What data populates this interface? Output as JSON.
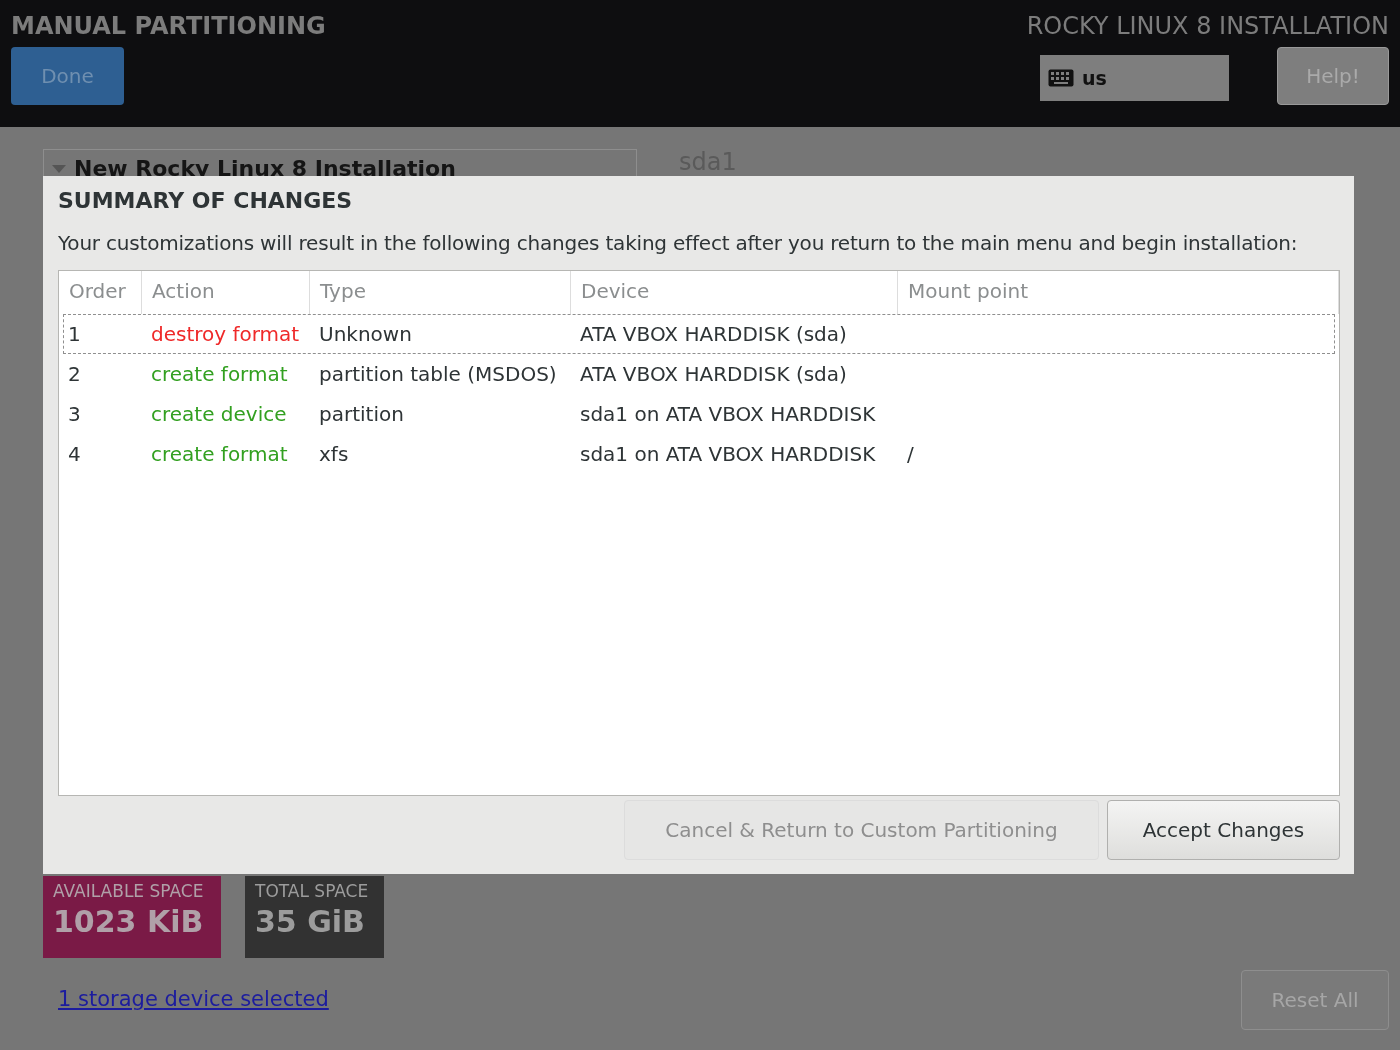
{
  "header": {
    "title": "MANUAL PARTITIONING",
    "done_button": "Done",
    "product": "ROCKY LINUX 8 INSTALLATION",
    "keyboard_layout": "us",
    "help_button": "Help!"
  },
  "background": {
    "tree_heading": "New Rocky Linux 8 Installation",
    "device_title": "sda1",
    "available_space": {
      "label": "AVAILABLE SPACE",
      "value": "1023 KiB"
    },
    "total_space": {
      "label": "TOTAL SPACE",
      "value": "35 GiB"
    },
    "storage_link": "1 storage device selected",
    "reset_button": "Reset All"
  },
  "dialog": {
    "title": "SUMMARY OF CHANGES",
    "message": "Your customizations will result in the following changes taking effect after you return to the main menu and begin installation:",
    "table": {
      "columns": [
        "Order",
        "Action",
        "Type",
        "Device",
        "Mount point"
      ],
      "rows": [
        {
          "order": "1",
          "action": "destroy format",
          "kind": "destroy",
          "type": "Unknown",
          "device": "ATA VBOX HARDDISK (sda)",
          "mount_point": "",
          "selected": true
        },
        {
          "order": "2",
          "action": "create format",
          "kind": "create",
          "type": "partition table (MSDOS)",
          "device": "ATA VBOX HARDDISK (sda)",
          "mount_point": "",
          "selected": false
        },
        {
          "order": "3",
          "action": "create device",
          "kind": "create",
          "type": "partition",
          "device": "sda1 on ATA VBOX HARDDISK",
          "mount_point": "",
          "selected": false
        },
        {
          "order": "4",
          "action": "create format",
          "kind": "create",
          "type": "xfs",
          "device": "sda1 on ATA VBOX HARDDISK",
          "mount_point": "/",
          "selected": false
        }
      ]
    },
    "cancel_button": {
      "label": "Cancel & Return to Custom Partitioning",
      "disabled": true
    },
    "accept_button": {
      "label": "Accept Changes",
      "disabled": false
    }
  }
}
